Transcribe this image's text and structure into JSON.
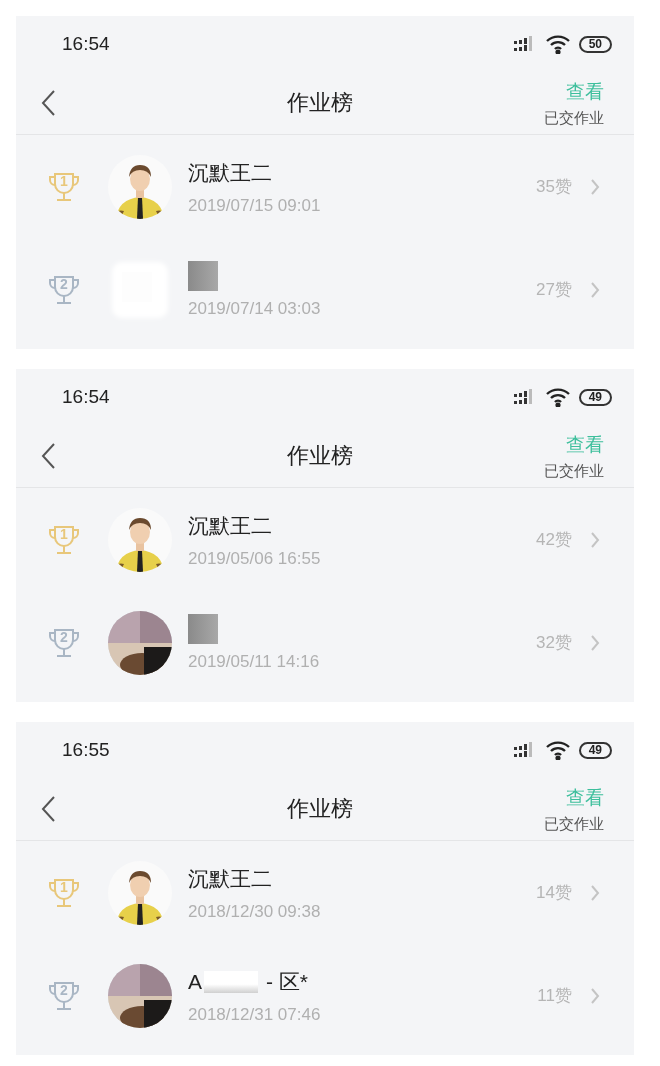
{
  "screens": [
    {
      "status_bar": {
        "time": "16:54",
        "battery": "50"
      },
      "nav": {
        "title": "作业榜",
        "action": "查看",
        "action_subtitle": "已交作业"
      },
      "rows": [
        {
          "rank": "1",
          "color": "#e8c77a",
          "avatar": {
            "kind": "figure"
          },
          "name_parts": [
            {
              "kind": "text",
              "text": "沉默王二"
            }
          ],
          "date": "2019/07/15 09:01",
          "likes": "35赞"
        },
        {
          "rank": "2",
          "color": "#a9b6c4",
          "avatar": {
            "kind": "blank"
          },
          "name_parts": [
            {
              "kind": "redaction"
            }
          ],
          "date": "2019/07/14 03:03",
          "likes": "27赞"
        }
      ]
    },
    {
      "status_bar": {
        "time": "16:54",
        "battery": "49"
      },
      "nav": {
        "title": "作业榜",
        "action": "查看",
        "action_subtitle": "已交作业"
      },
      "rows": [
        {
          "rank": "1",
          "color": "#e8c77a",
          "avatar": {
            "kind": "figure"
          },
          "name_parts": [
            {
              "kind": "text",
              "text": "沉默王二"
            }
          ],
          "date": "2019/05/06 16:55",
          "likes": "42赞"
        },
        {
          "rank": "2",
          "color": "#a9b6c4",
          "avatar": {
            "kind": "picture"
          },
          "name_parts": [
            {
              "kind": "redaction"
            }
          ],
          "date": "2019/05/11 14:16",
          "likes": "32赞"
        }
      ]
    },
    {
      "status_bar": {
        "time": "16:55",
        "battery": "49"
      },
      "nav": {
        "title": "作业榜",
        "action": "查看",
        "action_subtitle": "已交作业"
      },
      "rows": [
        {
          "rank": "1",
          "color": "#e8c77a",
          "avatar": {
            "kind": "figure"
          },
          "name_parts": [
            {
              "kind": "text",
              "text": "沉默王二"
            }
          ],
          "date": "2018/12/30 09:38",
          "likes": "14赞"
        },
        {
          "rank": "2",
          "color": "#a9b6c4",
          "avatar": {
            "kind": "picture"
          },
          "name_parts": [
            {
              "kind": "text",
              "text": "A"
            },
            {
              "kind": "redaction"
            },
            {
              "kind": "text",
              "text": "- 区*"
            }
          ],
          "date": "2018/12/31 07:46",
          "likes": "11赞"
        }
      ]
    }
  ]
}
